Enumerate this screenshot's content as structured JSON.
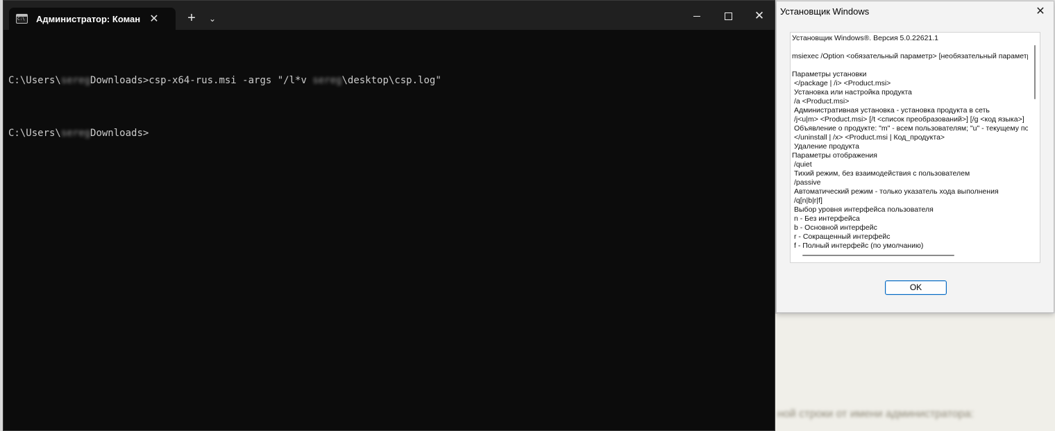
{
  "terminal": {
    "tab_title": "Администратор: Командн",
    "tab_close": "✕",
    "new_tab": "+",
    "dropdown": "⌄",
    "close": "✕",
    "lines": [
      {
        "prefix": "C:\\Users\\",
        "hidden": "sereg",
        "mid": "Downloads>csp-x64-rus.msi -args \"/l*v ",
        "hidden2": "sereg",
        "suffix": "\\desktop\\csp.log\""
      },
      {
        "prefix": "C:\\Users\\",
        "hidden": "sereg",
        "mid": "Downloads>",
        "hidden2": "",
        "suffix": ""
      }
    ]
  },
  "dialog": {
    "title": "Установщик Windows",
    "close": "✕",
    "ok_label": "OK",
    "text_lines": [
      {
        "t": "Установщик Windows®. Версия 5.0.22621.1",
        "i": false
      },
      {
        "t": "",
        "i": false
      },
      {
        "t": "msiexec /Option <обязательный параметр> [необязательный параметр]",
        "i": false
      },
      {
        "t": "",
        "i": false
      },
      {
        "t": "Параметры установки",
        "i": false
      },
      {
        "t": "</package | /i> <Product.msi>",
        "i": true
      },
      {
        "t": "Установка или настройка продукта",
        "i": true
      },
      {
        "t": "/a <Product.msi>",
        "i": true
      },
      {
        "t": "Административная установка - установка продукта в сеть",
        "i": true
      },
      {
        "t": "/j<u|m> <Product.msi> [/t <список преобразований>] [/g <код языка>]",
        "i": true
      },
      {
        "t": "Объявление о продукте: \"m\" - всем пользователям; \"u\" - текущему пользователю",
        "i": true
      },
      {
        "t": "</uninstall | /x> <Product.msi | Код_продукта>",
        "i": true
      },
      {
        "t": "Удаление продукта",
        "i": true
      },
      {
        "t": "Параметры отображения",
        "i": false
      },
      {
        "t": "/quiet",
        "i": true
      },
      {
        "t": "Тихий режим, без взаимодействия с пользователем",
        "i": true
      },
      {
        "t": "/passive",
        "i": true
      },
      {
        "t": "Автоматический режим - только указатель хода выполнения",
        "i": true
      },
      {
        "t": "/q[n|b|r|f]",
        "i": true
      },
      {
        "t": "Выбор уровня интерфейса пользователя",
        "i": true
      },
      {
        "t": "n - Без интерфейса",
        "i": true
      },
      {
        "t": "b - Основной интерфейс",
        "i": true
      },
      {
        "t": "r - Сокращенный интерфейс",
        "i": true
      },
      {
        "t": "f - Полный интерфейс (по умолчанию)",
        "i": true
      }
    ]
  },
  "background": {
    "blurred_text": "ной строки от имени администратора:"
  }
}
